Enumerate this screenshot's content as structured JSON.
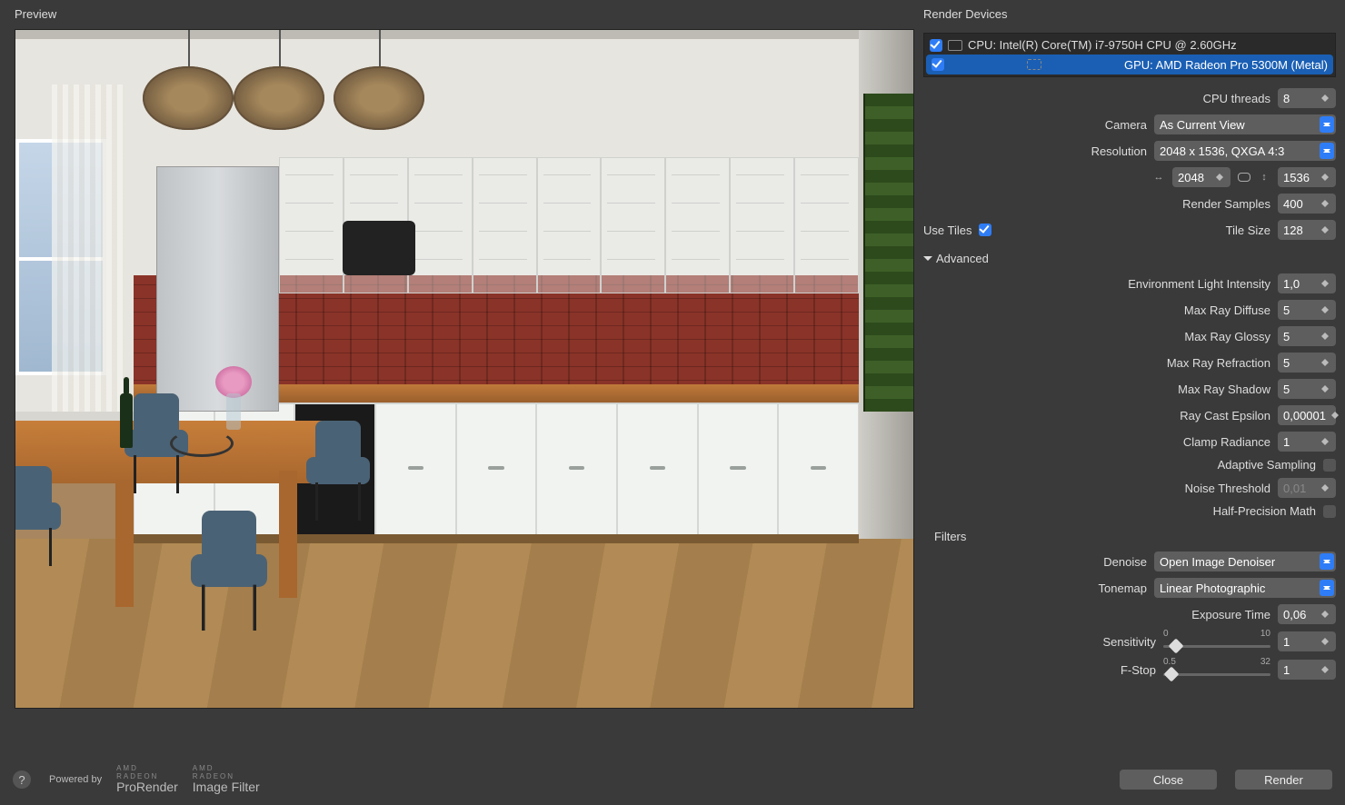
{
  "preview": {
    "label": "Preview"
  },
  "devices": {
    "label": "Render Devices",
    "cpu": {
      "checked": true,
      "text": "CPU: Intel(R) Core(TM) i7-9750H CPU @ 2.60GHz"
    },
    "gpu": {
      "checked": true,
      "text": "GPU: AMD Radeon Pro 5300M (Metal)"
    }
  },
  "settings": {
    "cpu_threads": {
      "label": "CPU threads",
      "value": "8"
    },
    "camera": {
      "label": "Camera",
      "value": "As Current View"
    },
    "resolution": {
      "label": "Resolution",
      "value": "2048 x 1536, QXGA 4:3",
      "w": "2048",
      "h": "1536"
    },
    "samples": {
      "label": "Render Samples",
      "value": "400"
    },
    "use_tiles": {
      "label": "Use Tiles",
      "checked": true
    },
    "tile_size": {
      "label": "Tile Size",
      "value": "128"
    }
  },
  "advanced": {
    "label": "Advanced",
    "env_light": {
      "label": "Environment Light Intensity",
      "value": "1,0"
    },
    "max_diffuse": {
      "label": "Max Ray Diffuse",
      "value": "5"
    },
    "max_glossy": {
      "label": "Max Ray Glossy",
      "value": "5"
    },
    "max_refraction": {
      "label": "Max Ray Refraction",
      "value": "5"
    },
    "max_shadow": {
      "label": "Max Ray Shadow",
      "value": "5"
    },
    "ray_epsilon": {
      "label": "Ray Cast Epsilon",
      "value": "0,00001"
    },
    "clamp_radiance": {
      "label": "Clamp Radiance",
      "value": "1"
    },
    "adaptive": {
      "label": "Adaptive Sampling",
      "checked": false
    },
    "noise_thresh": {
      "label": "Noise Threshold",
      "value": "0,01"
    },
    "half_precision": {
      "label": "Half-Precision Math",
      "checked": false
    }
  },
  "filters": {
    "label": "Filters",
    "denoise": {
      "label": "Denoise",
      "value": "Open Image Denoiser"
    },
    "tonemap": {
      "label": "Tonemap",
      "value": "Linear Photographic"
    },
    "exposure": {
      "label": "Exposure Time",
      "value": "0,06"
    },
    "sensitivity": {
      "label": "Sensitivity",
      "min": "0",
      "max": "10",
      "value": "1"
    },
    "fstop": {
      "label": "F-Stop",
      "min": "0.5",
      "max": "32",
      "value": "1"
    }
  },
  "footer": {
    "powered": "Powered by",
    "amd": "AMD",
    "radeon": "RADEON",
    "prorender": "ProRender",
    "imagefilter": "Image Filter",
    "close": "Close",
    "render": "Render"
  }
}
